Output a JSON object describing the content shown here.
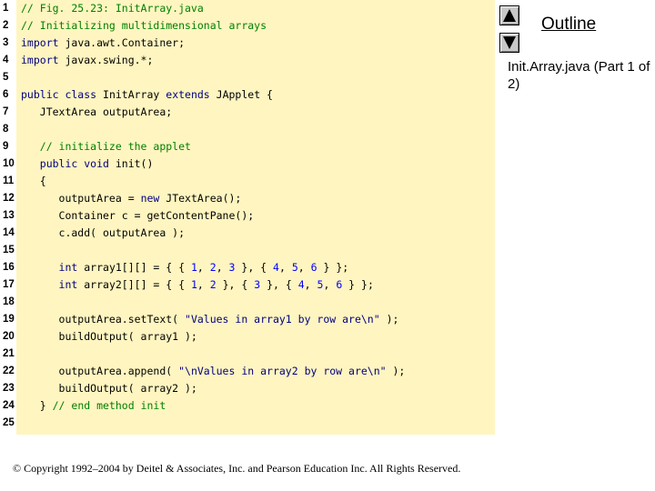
{
  "nav": {
    "up_icon": "triangle-up-icon",
    "down_icon": "triangle-down-icon"
  },
  "outline": {
    "label": "Outline"
  },
  "caption": {
    "text": "Init.Array.java (Part 1 of 2)"
  },
  "footer": {
    "copyright": "© Copyright 1992–2004 by Deitel & Associates, Inc. and Pearson Education Inc. All Rights Reserved."
  },
  "colors": {
    "code_background": "#fff5c0",
    "comment": "#008000",
    "keyword": "#000080",
    "number": "#0000ff"
  },
  "code": {
    "lines": [
      {
        "num": "1",
        "tokens": [
          {
            "t": "// Fig. 25.23: InitArray.java",
            "k": "comment"
          }
        ]
      },
      {
        "num": "2",
        "tokens": [
          {
            "t": "// Initializing multidimensional arrays",
            "k": "comment"
          }
        ]
      },
      {
        "num": "3",
        "tokens": [
          {
            "t": "import",
            "k": "keyword"
          },
          {
            "t": " java.awt.Container;",
            "k": "plain"
          }
        ]
      },
      {
        "num": "4",
        "tokens": [
          {
            "t": "import",
            "k": "keyword"
          },
          {
            "t": " javax.swing.*;",
            "k": "plain"
          }
        ]
      },
      {
        "num": "5",
        "tokens": []
      },
      {
        "num": "6",
        "tokens": [
          {
            "t": "public class",
            "k": "keyword"
          },
          {
            "t": " InitArray ",
            "k": "plain"
          },
          {
            "t": "extends",
            "k": "keyword"
          },
          {
            "t": " JApplet {",
            "k": "plain"
          }
        ]
      },
      {
        "num": "7",
        "tokens": [
          {
            "t": "   JTextArea outputArea;",
            "k": "plain"
          }
        ]
      },
      {
        "num": "8",
        "tokens": []
      },
      {
        "num": "9",
        "tokens": [
          {
            "t": "   // initialize the applet",
            "k": "comment"
          }
        ]
      },
      {
        "num": "10",
        "tokens": [
          {
            "t": "   public void",
            "k": "keyword"
          },
          {
            "t": " init()",
            "k": "plain"
          }
        ]
      },
      {
        "num": "11",
        "tokens": [
          {
            "t": "   {",
            "k": "plain"
          }
        ]
      },
      {
        "num": "12",
        "tokens": [
          {
            "t": "      outputArea = ",
            "k": "plain"
          },
          {
            "t": "new",
            "k": "keyword"
          },
          {
            "t": " JTextArea();",
            "k": "plain"
          }
        ]
      },
      {
        "num": "13",
        "tokens": [
          {
            "t": "      Container c = getContentPane();",
            "k": "plain"
          }
        ]
      },
      {
        "num": "14",
        "tokens": [
          {
            "t": "      c.add( outputArea );",
            "k": "plain"
          }
        ]
      },
      {
        "num": "15",
        "tokens": []
      },
      {
        "num": "16",
        "tokens": [
          {
            "t": "      ",
            "k": "plain"
          },
          {
            "t": "int",
            "k": "keyword"
          },
          {
            "t": " array1[][] = { { ",
            "k": "plain"
          },
          {
            "t": "1",
            "k": "number"
          },
          {
            "t": ", ",
            "k": "plain"
          },
          {
            "t": "2",
            "k": "number"
          },
          {
            "t": ", ",
            "k": "plain"
          },
          {
            "t": "3",
            "k": "number"
          },
          {
            "t": " }, { ",
            "k": "plain"
          },
          {
            "t": "4",
            "k": "number"
          },
          {
            "t": ", ",
            "k": "plain"
          },
          {
            "t": "5",
            "k": "number"
          },
          {
            "t": ", ",
            "k": "plain"
          },
          {
            "t": "6",
            "k": "number"
          },
          {
            "t": " } };",
            "k": "plain"
          }
        ]
      },
      {
        "num": "17",
        "tokens": [
          {
            "t": "      ",
            "k": "plain"
          },
          {
            "t": "int",
            "k": "keyword"
          },
          {
            "t": " array2[][] = { { ",
            "k": "plain"
          },
          {
            "t": "1",
            "k": "number"
          },
          {
            "t": ", ",
            "k": "plain"
          },
          {
            "t": "2",
            "k": "number"
          },
          {
            "t": " }, { ",
            "k": "plain"
          },
          {
            "t": "3",
            "k": "number"
          },
          {
            "t": " }, { ",
            "k": "plain"
          },
          {
            "t": "4",
            "k": "number"
          },
          {
            "t": ", ",
            "k": "plain"
          },
          {
            "t": "5",
            "k": "number"
          },
          {
            "t": ", ",
            "k": "plain"
          },
          {
            "t": "6",
            "k": "number"
          },
          {
            "t": " } };",
            "k": "plain"
          }
        ]
      },
      {
        "num": "18",
        "tokens": []
      },
      {
        "num": "19",
        "tokens": [
          {
            "t": "      outputArea.setText( ",
            "k": "plain"
          },
          {
            "t": "\"Values in array1 by row are\\n\"",
            "k": "string"
          },
          {
            "t": " );",
            "k": "plain"
          }
        ]
      },
      {
        "num": "20",
        "tokens": [
          {
            "t": "      buildOutput( array1 );",
            "k": "plain"
          }
        ]
      },
      {
        "num": "21",
        "tokens": []
      },
      {
        "num": "22",
        "tokens": [
          {
            "t": "      outputArea.append( ",
            "k": "plain"
          },
          {
            "t": "\"\\nValues in array2 by row are\\n\"",
            "k": "string"
          },
          {
            "t": " );",
            "k": "plain"
          }
        ]
      },
      {
        "num": "23",
        "tokens": [
          {
            "t": "      buildOutput( array2 );",
            "k": "plain"
          }
        ]
      },
      {
        "num": "24",
        "tokens": [
          {
            "t": "   } ",
            "k": "plain"
          },
          {
            "t": "// end method init",
            "k": "comment"
          }
        ]
      },
      {
        "num": "25",
        "tokens": []
      }
    ]
  }
}
